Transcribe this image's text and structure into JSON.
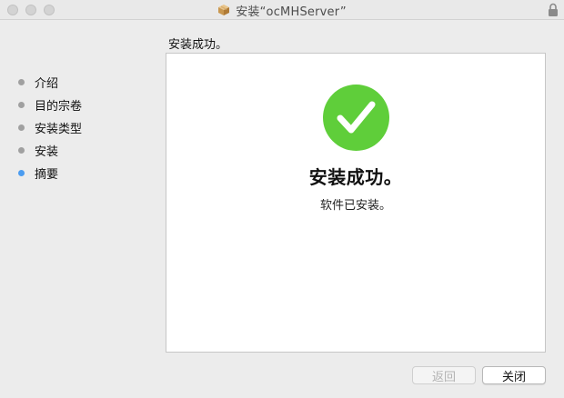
{
  "window": {
    "title": "安装“ocMHServer”"
  },
  "sidebar": {
    "steps": [
      {
        "label": "介绍",
        "active": false
      },
      {
        "label": "目的宗卷",
        "active": false
      },
      {
        "label": "安装类型",
        "active": false
      },
      {
        "label": "安装",
        "active": false
      },
      {
        "label": "摘要",
        "active": true
      }
    ]
  },
  "main": {
    "section_title": "安装成功。",
    "heading": "安装成功。",
    "subtext": "软件已安装。"
  },
  "buttons": {
    "back_label": "返回",
    "close_label": "关闭"
  },
  "colors": {
    "success_green": "#5fce3a",
    "active_step": "#4b9cf0",
    "inactive_step": "#a0a0a0"
  },
  "icons": {
    "title_icon": "package-icon",
    "lock": "lock-icon",
    "success": "checkmark-circle-icon"
  }
}
